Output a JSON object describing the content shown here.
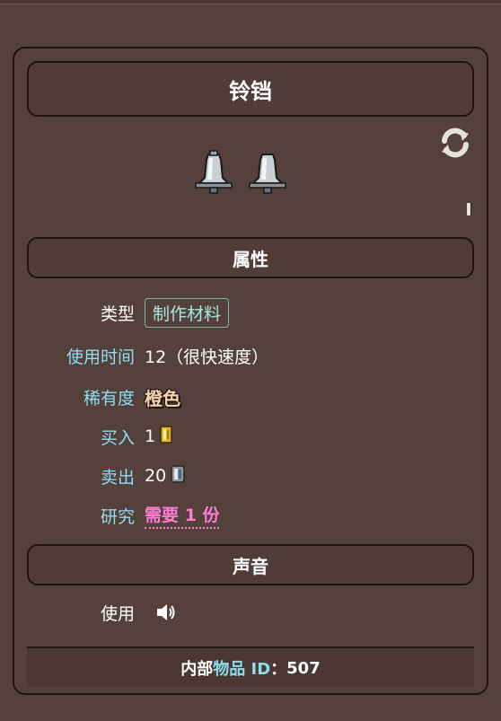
{
  "item": {
    "name": "铃铛",
    "icons": {
      "bell": "bell-icon",
      "refresh": "refresh-icon",
      "speaker": "speaker-icon",
      "gold_coin": "gold-coin-icon",
      "silver_coin": "silver-coin-icon"
    }
  },
  "sections": {
    "attributes": "属性",
    "sound": "声音"
  },
  "attributes": {
    "type": {
      "label": "类型",
      "value": "制作材料"
    },
    "use_time": {
      "label": "使用时间",
      "value": "12（很快速度）"
    },
    "rarity": {
      "label": "稀有度",
      "value": "橙色",
      "color": "#fad3ad"
    },
    "buy": {
      "label": "买入",
      "value": "1"
    },
    "sell": {
      "label": "卖出",
      "value": "20"
    },
    "research": {
      "label": "研究",
      "value": "需要 1 份",
      "color": "#ff7ad2"
    }
  },
  "sound": {
    "use_label": "使用"
  },
  "footer": {
    "prefix_1": "内部",
    "prefix_2": "物品 ID",
    "prefix_3": "：",
    "id": "507"
  },
  "colors": {
    "background": "#55413b",
    "label": "#8fdcf0",
    "border": "#1e1412"
  }
}
